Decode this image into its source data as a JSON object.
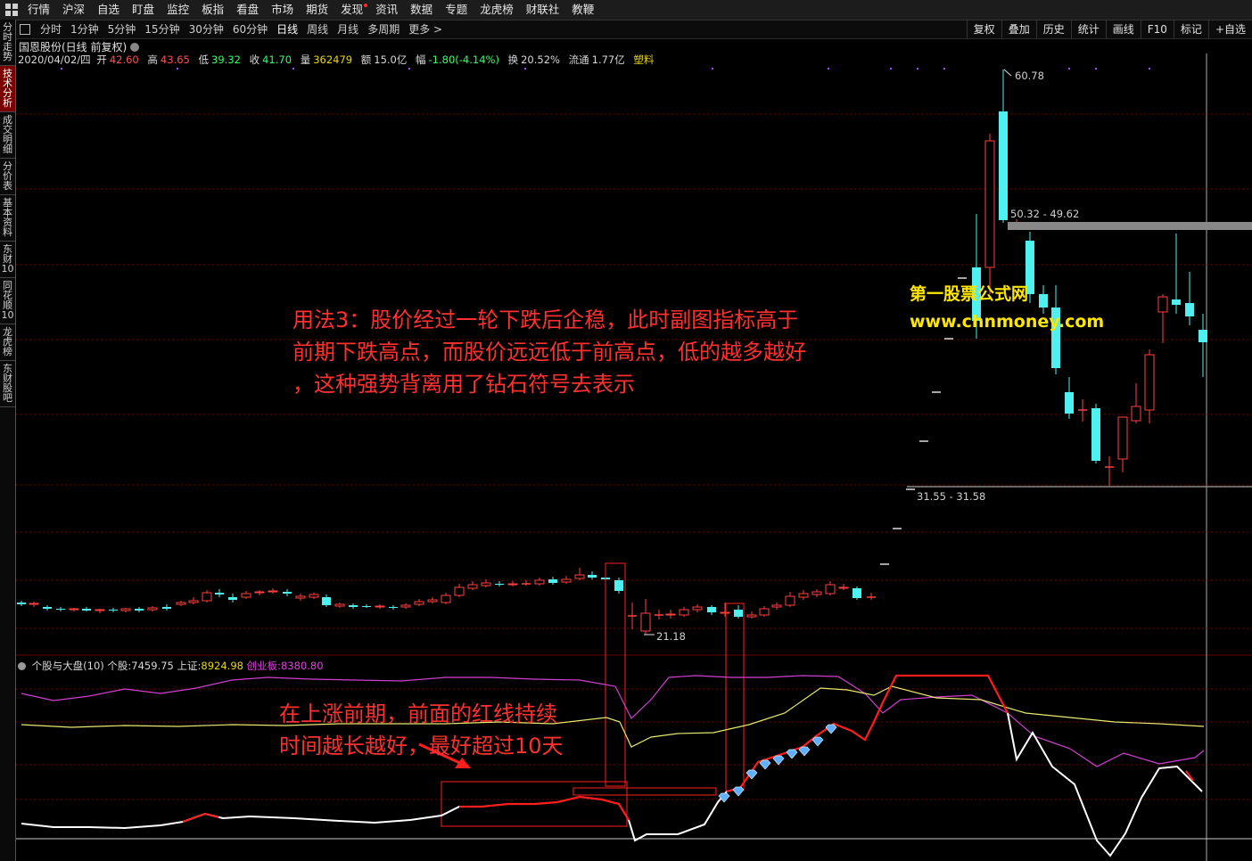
{
  "menu": {
    "items": [
      {
        "label": "行情"
      },
      {
        "label": "沪深"
      },
      {
        "label": "自选"
      },
      {
        "label": "盯盘"
      },
      {
        "label": "监控"
      },
      {
        "label": "板指"
      },
      {
        "label": "看盘"
      },
      {
        "label": "市场"
      },
      {
        "label": "期货"
      },
      {
        "label": "发现",
        "dot": true
      },
      {
        "label": "资讯"
      },
      {
        "label": "数据"
      },
      {
        "label": "专题"
      },
      {
        "label": "龙虎榜"
      },
      {
        "label": "财联社"
      },
      {
        "label": "教鞭"
      }
    ]
  },
  "sidebar": {
    "items": [
      {
        "label": "分时走势",
        "active": false
      },
      {
        "label": "技术分析",
        "active": true
      },
      {
        "label": "成交明细",
        "active": false
      },
      {
        "label": "分价表",
        "active": false
      },
      {
        "label": "基本资料",
        "active": false
      },
      {
        "label": "东财10",
        "active": false
      },
      {
        "label": "同花顺10",
        "active": false
      },
      {
        "label": "龙虎榜",
        "active": false
      },
      {
        "label": "东财股吧",
        "active": false
      }
    ]
  },
  "toolbar": {
    "periods": [
      {
        "label": "分时",
        "active": false
      },
      {
        "label": "1分钟",
        "active": false
      },
      {
        "label": "5分钟",
        "active": false
      },
      {
        "label": "15分钟",
        "active": false
      },
      {
        "label": "30分钟",
        "active": false
      },
      {
        "label": "60分钟",
        "active": false
      },
      {
        "label": "日线",
        "active": true
      },
      {
        "label": "周线",
        "active": false
      },
      {
        "label": "月线",
        "active": false
      },
      {
        "label": "多周期",
        "active": false
      },
      {
        "label": "更多 >",
        "active": false
      }
    ],
    "right_tools": [
      {
        "label": "复权"
      },
      {
        "label": "叠加"
      },
      {
        "label": "历史"
      },
      {
        "label": "统计"
      },
      {
        "label": "画线"
      },
      {
        "label": "F10"
      },
      {
        "label": "标记"
      },
      {
        "label": "+自选"
      }
    ]
  },
  "stock": {
    "title": "国恩股份(日线 前复权)",
    "quote": {
      "date": "2020/04/02/四",
      "open_label": "开",
      "open": "42.60",
      "high_label": "高",
      "high": "43.65",
      "low_label": "低",
      "low": "39.32",
      "close_label": "收",
      "close": "41.70",
      "vol_label": "量",
      "vol": "362479",
      "amt_label": "额",
      "amt": "15.0亿",
      "chg_label": "幅",
      "chg": "-1.80(-4.14%)",
      "turn_label": "换",
      "turn": "20.52%",
      "float_label": "流通",
      "float": "1.77亿",
      "sector": "塑料"
    }
  },
  "price_labels": {
    "high_peak": "60.78",
    "band_upper": "50.32 - 49.62",
    "band_lower": "31.55 - 31.58",
    "low_mark": "21.18"
  },
  "indicator": {
    "name": "个股与大盘(10)",
    "stock_label": "个股:",
    "stock_value": "7459.75",
    "sh_label": "上证:",
    "sh_value": "8924.98",
    "cyb_label": "创业板:",
    "cyb_value": "8380.80"
  },
  "annotations": {
    "note1_line1": "用法3：股价经过一轮下跌后企稳，此时副图指标高于",
    "note1_line2": "前期下跌高点，而股价远远低于前高点，低的越多越好",
    "note1_line3": "，这种强势背离用了钻石符号去表示",
    "note2_line1": "在上涨前期，前面的红线持续",
    "note2_line2": "时间越长越好，最好超过10天",
    "watermark_cn": "第一股票公式网",
    "watermark_url": "www.chnmoney.com"
  },
  "colors": {
    "up": "#ff4040",
    "down": "#4ef0f0",
    "stock_line": "#ffffff",
    "strong_line": "#ff1e1e",
    "sh_line": "#e8e870",
    "cyb_line": "#d040d0",
    "grid": "#7a0000",
    "diamond": "#5fb0ff"
  }
}
